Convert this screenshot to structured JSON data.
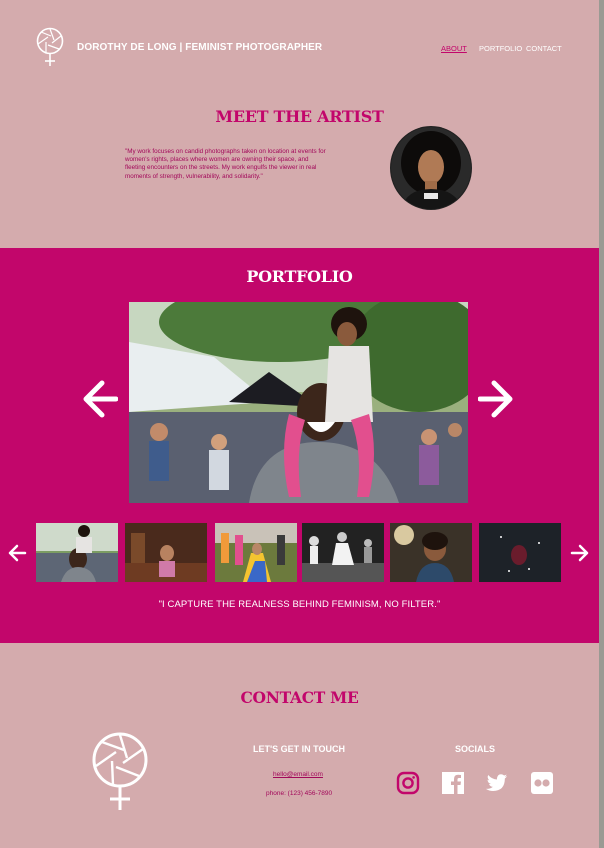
{
  "header": {
    "brand": "DOROTHY DE LONG | FEMINIST PHOTOGRAPHER",
    "nav": {
      "about": "ABOUT",
      "portfolio": "PORTFOLIO",
      "contact": "CONTACT"
    }
  },
  "about": {
    "title": "MEET THE ARTIST",
    "text": "\"My work focuses on candid photographs taken on location at events for women's rights, places where women are owning their space, and fleeting encounters on the streets. My work engulfs the viewer in real moments of strength, vulnerability, and solidarity.\""
  },
  "portfolio": {
    "title": "PORTFOLIO",
    "quote": "\"I CAPTURE THE REALNESS BEHIND FEMINISM, NO FILTER.\""
  },
  "contact": {
    "title": "CONTACT ME",
    "touch_heading": "LET'S GET IN TOUCH",
    "email": "hello@email.com",
    "phone": "phone: (123) 456-7890",
    "socials_heading": "SOCIALS"
  },
  "colors": {
    "accent": "#c2066b",
    "background": "#d4abad"
  },
  "icons": [
    "camera-aperture-venus-logo-icon",
    "arrow-left-icon",
    "arrow-right-icon",
    "instagram-icon",
    "facebook-icon",
    "twitter-icon",
    "flickr-icon"
  ]
}
